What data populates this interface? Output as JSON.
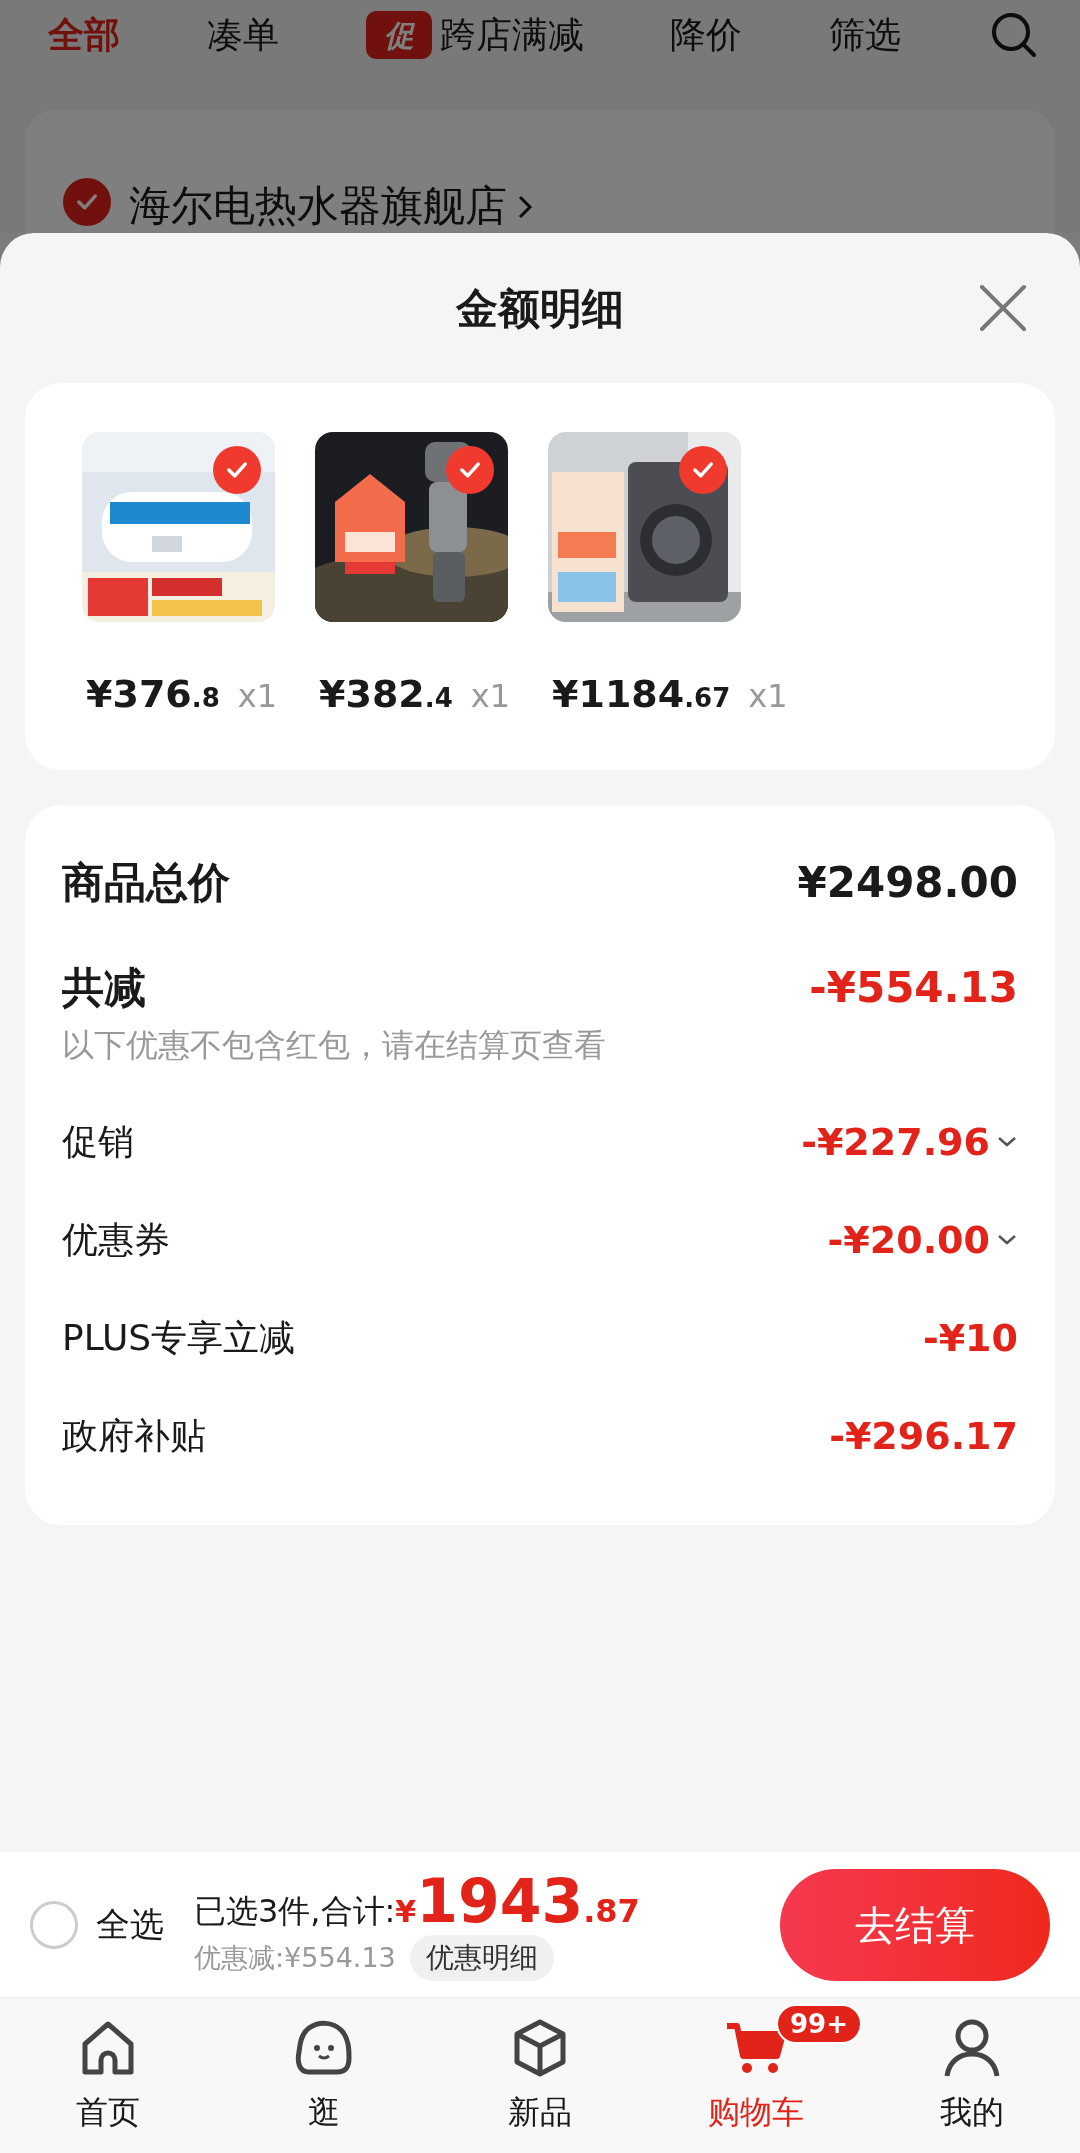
{
  "top_tabs": [
    {
      "label": "全部",
      "selected": true,
      "kind": "text"
    },
    {
      "label": "凑单",
      "selected": false,
      "kind": "text"
    },
    {
      "label": "跨店满减",
      "selected": false,
      "kind": "promo",
      "badge": "促"
    },
    {
      "label": "降价",
      "selected": false,
      "kind": "text"
    },
    {
      "label": "筛选",
      "selected": false,
      "kind": "text"
    }
  ],
  "store": {
    "name": "海尔电热水器旗舰店",
    "checked": true
  },
  "sheet": {
    "title": "金额明细",
    "products": [
      {
        "price": "¥376",
        "price_decimal": ".8",
        "quantity": "x1",
        "selected": true,
        "kind": "picture"
      },
      {
        "price": "¥382",
        "price_decimal": ".4",
        "quantity": "x1",
        "selected": true,
        "kind": "picture"
      },
      {
        "price": "¥1184",
        "price_decimal": ".67",
        "quantity": "x1",
        "selected": true,
        "kind": "picture"
      }
    ],
    "summary": [
      {
        "kind": "total",
        "label": "商品总价",
        "value": "¥2498.00"
      },
      {
        "kind": "discount_total",
        "label": "共减",
        "value": "-¥554.13",
        "note": "以下优惠不包含红包，请在结算页查看"
      },
      {
        "kind": "detail",
        "label": "促销",
        "value": "-¥227.96",
        "expandable": true
      },
      {
        "kind": "detail",
        "label": "优惠券",
        "value": "-¥20.00",
        "expandable": true
      },
      {
        "kind": "detail",
        "label": "PLUS专享立减",
        "value": "-¥10",
        "expandable": false
      },
      {
        "kind": "detail",
        "label": "政府补贴",
        "value": "-¥296.17",
        "expandable": false
      }
    ]
  },
  "checkout_bar": {
    "select_all": {
      "label": "全选",
      "checked": false
    },
    "summary": "已选3件,合计:",
    "currency": "¥",
    "total": "1943",
    "total_decimal": ".87",
    "saving": "优惠减:¥554.13",
    "detail_button": "优惠明细",
    "checkout_button": "去结算"
  },
  "bottom_nav": [
    {
      "label": "首页",
      "selected": false
    },
    {
      "label": "逛",
      "selected": false
    },
    {
      "label": "新品",
      "selected": false
    },
    {
      "label": "购物车",
      "selected": true,
      "badge": "99+"
    },
    {
      "label": "我的",
      "selected": false
    }
  ]
}
